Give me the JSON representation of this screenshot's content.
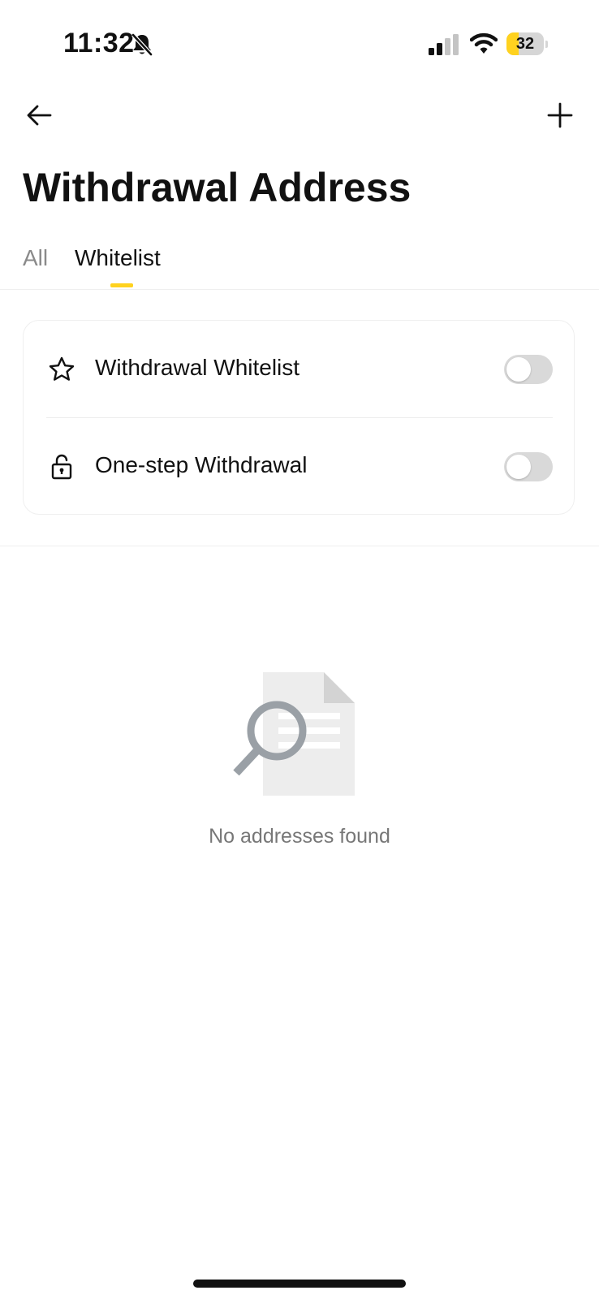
{
  "status_bar": {
    "time": "11:32",
    "battery_level": 32,
    "battery_label": "32",
    "icons": [
      "bell-off-icon",
      "signal-icon",
      "wifi-icon",
      "battery-icon"
    ]
  },
  "nav": {
    "back_icon": "arrow-left-icon",
    "add_icon": "plus-icon"
  },
  "page": {
    "title": "Withdrawal Address"
  },
  "tabs": [
    {
      "label": "All",
      "active": false
    },
    {
      "label": "Whitelist",
      "active": true
    }
  ],
  "settings": [
    {
      "icon": "star-icon",
      "label": "Withdrawal Whitelist",
      "enabled": false
    },
    {
      "icon": "unlock-icon",
      "label": "One-step Withdrawal",
      "enabled": false
    }
  ],
  "empty_state": {
    "icon": "search-document-icon",
    "message": "No addresses found"
  },
  "colors": {
    "accent": "#ffd21f",
    "text_primary": "#111111",
    "text_secondary": "#777777",
    "toggle_off": "#d9d9d9"
  }
}
